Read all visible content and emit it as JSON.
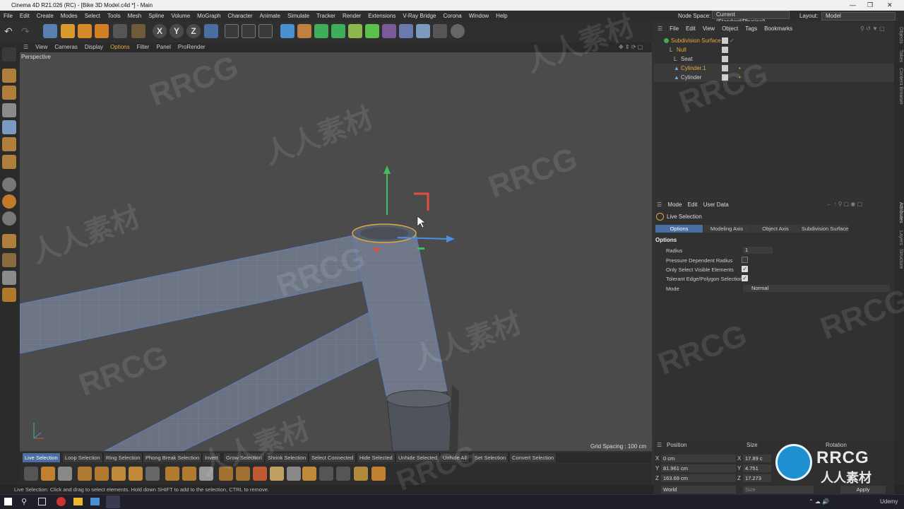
{
  "window": {
    "title": "Cinema 4D R21.026 (RC) - [Bike 3D Model.c4d *] - Main"
  },
  "menubar": {
    "items": [
      "File",
      "Edit",
      "Create",
      "Modes",
      "Select",
      "Tools",
      "Mesh",
      "Spline",
      "Volume",
      "MoGraph",
      "Character",
      "Animate",
      "Simulate",
      "Tracker",
      "Render",
      "Extensions",
      "V-Ray Bridge",
      "Corona",
      "Window",
      "Help"
    ],
    "node_space_label": "Node Space:",
    "node_space_value": "Current (Standard/Physical)",
    "layout_label": "Layout:",
    "layout_value": "Model"
  },
  "viewport": {
    "menu": [
      "View",
      "Cameras",
      "Display",
      "Options",
      "Filter",
      "Panel",
      "ProRender"
    ],
    "active_menu": "Options",
    "label": "Perspective",
    "grid_spacing": "Grid Spacing : 100 cm"
  },
  "axis_buttons": [
    "X",
    "Y",
    "Z"
  ],
  "selection_commands": [
    "Live Selection",
    "Loop Selection",
    "Ring Selection",
    "Phong Break Selection",
    "Invert",
    "Grow Selection",
    "Shrink Selection",
    "Select Connected",
    "Hide Selected",
    "Unhide Selected",
    "Unhide All",
    "Set Selection",
    "Convert Selection"
  ],
  "status_text": "Live Selection: Click and drag to select elements. Hold down SHIFT to add to the selection, CTRL to remove.",
  "object_manager": {
    "menu": [
      "File",
      "Edit",
      "View",
      "Object",
      "Tags",
      "Bookmarks"
    ],
    "objects": [
      {
        "name": "Subdivision Surface",
        "indent": 0
      },
      {
        "name": "Null",
        "indent": 1
      },
      {
        "name": "Seat",
        "indent": 2
      },
      {
        "name": "Cylinder.1",
        "indent": 2
      },
      {
        "name": "Cylinder",
        "indent": 2
      }
    ],
    "colors": {
      "active": "#e8a640",
      "normal": "#d0d0d0"
    }
  },
  "attributes": {
    "menu": [
      "Mode",
      "Edit",
      "User Data"
    ],
    "tool_name": "Live Selection",
    "tabs": [
      "Options",
      "Modeling Axis",
      "Object Axis",
      "Subdivision Surface"
    ],
    "active_tab": "Options",
    "section": "Options",
    "fields": {
      "radius_label": "Radius",
      "radius_value": "1",
      "pressure_label": "Pressure Dependent Radius",
      "visible_label": "Only Select Visible Elements",
      "tolerant_label": "Tolerant Edge/Polygon Selection",
      "mode_label": "Mode",
      "mode_value": "Normal"
    },
    "checks": {
      "pressure": false,
      "visible": true,
      "tolerant": true
    }
  },
  "coordinates": {
    "headers": [
      "Position",
      "Size",
      "Rotation"
    ],
    "axes": [
      "X",
      "Y",
      "Z"
    ],
    "position": [
      "0 cm",
      "81.961 cm",
      "163.69 cm"
    ],
    "size": [
      "17.89 c",
      "4.751",
      "17.273"
    ],
    "world": "World",
    "size_mode": "Size",
    "apply": "Apply"
  },
  "side_tabs": [
    "Objects",
    "Takes",
    "Content Browser",
    "Attributes",
    "Layers",
    "Structure"
  ],
  "watermarks": [
    "RRCG",
    "人人素材"
  ],
  "taskbar": {
    "right_text": "Udemy"
  }
}
